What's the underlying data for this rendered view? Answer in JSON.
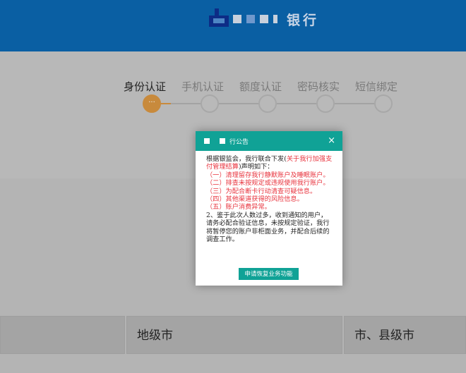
{
  "header": {
    "bank_name": "银行",
    "brand_color": "#0a5fa3"
  },
  "steps": [
    {
      "label": "身份认证",
      "active": true,
      "marker": "···"
    },
    {
      "label": "手机认证"
    },
    {
      "label": "额度认证"
    },
    {
      "label": "密码核实"
    },
    {
      "label": "短信绑定"
    }
  ],
  "dropdowns": [
    {
      "value": ""
    },
    {
      "value": "地级市"
    },
    {
      "value": "市、县级市"
    }
  ],
  "modal": {
    "title": "行公告",
    "close": "×",
    "p1_start": "根据银监会，我行联合下发(",
    "p1_red": "关于我行加强支付管理结算",
    "p1_end": ")声明如下：",
    "items": [
      "（一）清理留存我行静默账户及睡眠账户。",
      "（二）排查未按规定或违规使用我行账户。",
      "（三）为配合断卡行动清查可疑信息。",
      "（四）其他渠道获得的风险信息。",
      "（五）账户消费异常。"
    ],
    "p2": " 2、鉴于此次人数过多，收到通知的用户，请务必配合验证信息，未按规定验证，我行将暂停您的账户非柜面业务，并配合后续的调查工作。",
    "button": "申请恢复业务功能",
    "accent_color": "#10a296"
  }
}
